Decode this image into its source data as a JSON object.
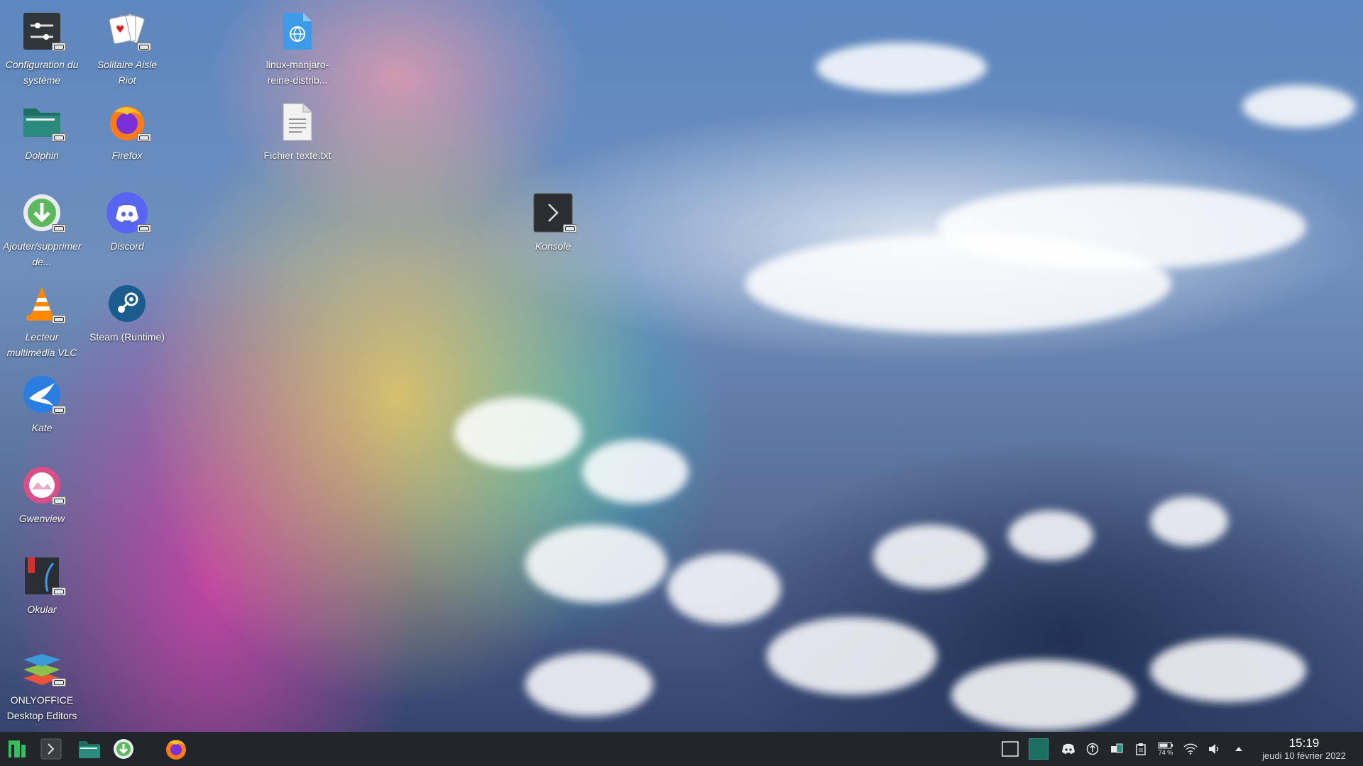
{
  "desktop": {
    "icons": [
      {
        "label": "Configuration du système",
        "icon": "system-settings-icon"
      },
      {
        "label": "Solitaire Aisle Riot",
        "icon": "playing-cards-icon"
      },
      {
        "label": "linux-manjaro-reine-distrib...",
        "icon": "web-link-file-icon"
      },
      {
        "label": "Dolphin",
        "icon": "folder-icon"
      },
      {
        "label": "Firefox",
        "icon": "firefox-icon"
      },
      {
        "label": "Fichier texte.txt",
        "icon": "text-file-icon"
      },
      {
        "label": "Ajouter/supprimer de...",
        "icon": "download-icon"
      },
      {
        "label": "Discord",
        "icon": "discord-icon"
      },
      {
        "label": "Konsole",
        "icon": "terminal-icon"
      },
      {
        "label": "Lecteur multimédia VLC",
        "icon": "vlc-cone-icon"
      },
      {
        "label": "Steam (Runtime)",
        "icon": "steam-icon"
      },
      {
        "label": "Kate",
        "icon": "kate-bird-icon"
      },
      {
        "label": "Gwenview",
        "icon": "gwenview-icon"
      },
      {
        "label": "Okular",
        "icon": "okular-icon"
      },
      {
        "label": "ONLYOFFICE Desktop Editors",
        "icon": "onlyoffice-layers-icon"
      }
    ]
  },
  "taskbar": {
    "apps": [
      "manjaro-menu-icon",
      "terminal-icon",
      "folder-icon",
      "download-icon",
      "firefox-icon"
    ],
    "tray": {
      "battery_percent": "74 %",
      "time": "15:19",
      "date": "jeudi 10 février 2022"
    }
  },
  "colors": {
    "taskbar_bg": "#22262b",
    "manjaro_green": "#35bf5c",
    "discord_blue": "#5865f2",
    "dolphin_teal": "#1e6f63"
  }
}
